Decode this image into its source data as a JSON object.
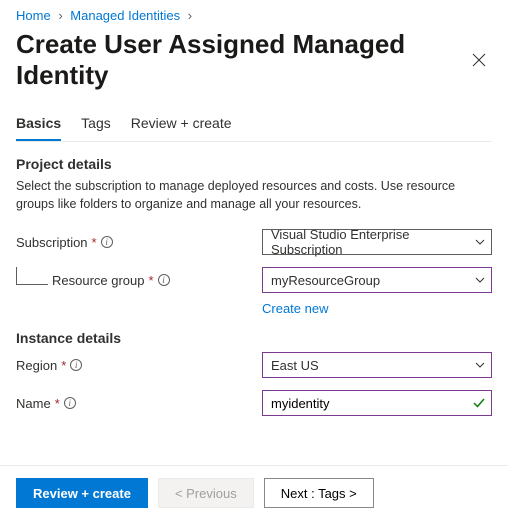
{
  "breadcrumb": {
    "home": "Home",
    "mi": "Managed Identities"
  },
  "title": "Create User Assigned Managed Identity",
  "tabs": {
    "basics": "Basics",
    "tags": "Tags",
    "review": "Review + create"
  },
  "project": {
    "heading": "Project details",
    "description": "Select the subscription to manage deployed resources and costs. Use resource groups like folders to organize and manage all your resources.",
    "subscription_label": "Subscription",
    "subscription_value": "Visual Studio Enterprise Subscription",
    "rg_label": "Resource group",
    "rg_value": "myResourceGroup",
    "create_new": "Create new"
  },
  "instance": {
    "heading": "Instance details",
    "region_label": "Region",
    "region_value": "East US",
    "name_label": "Name",
    "name_value": "myidentity"
  },
  "footer": {
    "review": "Review + create",
    "prev": "< Previous",
    "next": "Next : Tags >"
  }
}
